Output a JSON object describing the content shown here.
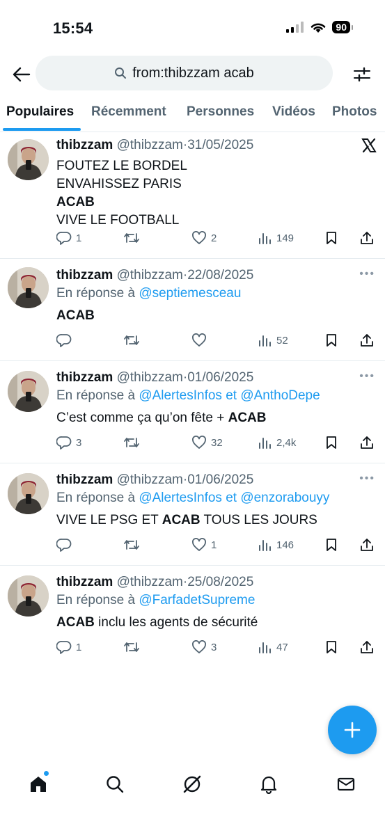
{
  "status_bar": {
    "time": "15:54",
    "battery": "90"
  },
  "search": {
    "query": "from:thibzzam acab"
  },
  "tabs": [
    {
      "label": "Populaires"
    },
    {
      "label": "Récemment"
    },
    {
      "label": "Personnes"
    },
    {
      "label": "Vidéos"
    },
    {
      "label": "Photos"
    }
  ],
  "tweets": [
    {
      "name": "thibzzam",
      "handle": "@thibzzam",
      "dot": "·",
      "date": "31/05/2025",
      "lines": [
        "FOUTEZ LE BORDEL",
        "ENVAHISSEZ PARIS",
        "ACAB",
        "VIVE LE FOOTBALL"
      ],
      "replies": "1",
      "retweets": "",
      "likes": "2",
      "views": "149"
    },
    {
      "name": "thibzzam",
      "handle": "@thibzzam",
      "dot": "·",
      "date": "22/08/2025",
      "reply_prefix": "En réponse à",
      "reply_mentions": "@septiemesceau",
      "bold": "ACAB",
      "text_after": "",
      "replies": "",
      "retweets": "",
      "likes": "",
      "views": "52"
    },
    {
      "name": "thibzzam",
      "handle": "@thibzzam",
      "dot": "·",
      "date": "01/06/2025",
      "reply_prefix": "En réponse à",
      "reply_mentions": "@AlertesInfos et @AnthoDepe",
      "text_before": "C’est comme ça qu’on fête + ",
      "bold": "ACAB",
      "replies": "3",
      "retweets": "",
      "likes": "32",
      "views": "2,4k"
    },
    {
      "name": "thibzzam",
      "handle": "@thibzzam",
      "dot": "·",
      "date": "01/06/2025",
      "reply_prefix": "En réponse à",
      "reply_mentions": "@AlertesInfos et @enzorabouyy",
      "text_before": "VIVE LE PSG ET ",
      "bold": "ACAB",
      "text_after": " TOUS LES JOURS",
      "replies": "",
      "retweets": "",
      "likes": "1",
      "views": "146"
    },
    {
      "name": "thibzzam",
      "handle": "@thibzzam",
      "dot": "·",
      "date": "25/08/2025",
      "reply_prefix": "En réponse à",
      "reply_mentions": "@FarfadetSupreme",
      "bold": "ACAB",
      "text_after": " inclu les agents de sécurité",
      "replies": "1",
      "retweets": "",
      "likes": "3",
      "views": "47"
    }
  ],
  "colors": {
    "accent": "#1d9bf0",
    "secondary_text": "#536471",
    "primary_text": "#0f1419"
  },
  "icons": {
    "nav": [
      "home-icon",
      "search-icon",
      "grok-icon",
      "notifications-icon",
      "messages-icon"
    ],
    "actions": [
      "reply-icon",
      "retweet-icon",
      "like-icon",
      "views-icon",
      "bookmark-icon",
      "share-icon"
    ]
  }
}
